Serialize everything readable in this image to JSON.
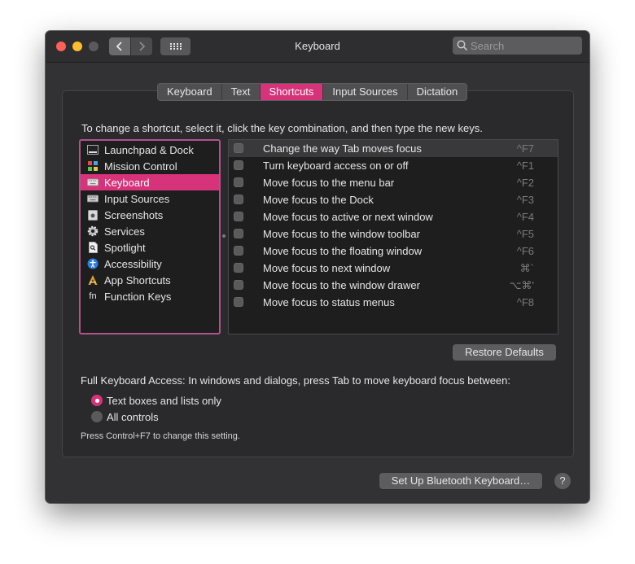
{
  "window": {
    "title": "Keyboard",
    "search_placeholder": "Search"
  },
  "tabs": [
    {
      "label": "Keyboard",
      "active": false
    },
    {
      "label": "Text",
      "active": false
    },
    {
      "label": "Shortcuts",
      "active": true
    },
    {
      "label": "Input Sources",
      "active": false
    },
    {
      "label": "Dictation",
      "active": false
    }
  ],
  "instructions": "To change a shortcut, select it, click the key combination, and then type the new keys.",
  "categories": [
    {
      "label": "Launchpad & Dock",
      "icon": "launchpad-dock-icon",
      "selected": false
    },
    {
      "label": "Mission Control",
      "icon": "mission-control-icon",
      "selected": false
    },
    {
      "label": "Keyboard",
      "icon": "keyboard-icon",
      "selected": true
    },
    {
      "label": "Input Sources",
      "icon": "input-sources-icon",
      "selected": false
    },
    {
      "label": "Screenshots",
      "icon": "screenshots-icon",
      "selected": false
    },
    {
      "label": "Services",
      "icon": "gear-icon",
      "selected": false
    },
    {
      "label": "Spotlight",
      "icon": "spotlight-icon",
      "selected": false
    },
    {
      "label": "Accessibility",
      "icon": "accessibility-icon",
      "selected": false
    },
    {
      "label": "App Shortcuts",
      "icon": "app-shortcuts-icon",
      "selected": false
    },
    {
      "label": "Function Keys",
      "icon": "fn-icon",
      "selected": false
    }
  ],
  "shortcuts": [
    {
      "label": "Change the way Tab moves focus",
      "key": "^F7",
      "checked": false
    },
    {
      "label": "Turn keyboard access on or off",
      "key": "^F1",
      "checked": false
    },
    {
      "label": "Move focus to the menu bar",
      "key": "^F2",
      "checked": false
    },
    {
      "label": "Move focus to the Dock",
      "key": "^F3",
      "checked": false
    },
    {
      "label": "Move focus to active or next window",
      "key": "^F4",
      "checked": false
    },
    {
      "label": "Move focus to the window toolbar",
      "key": "^F5",
      "checked": false
    },
    {
      "label": "Move focus to the floating window",
      "key": "^F6",
      "checked": false
    },
    {
      "label": "Move focus to next window",
      "key": "⌘`",
      "checked": false
    },
    {
      "label": "Move focus to the window drawer",
      "key": "⌥⌘'",
      "checked": false
    },
    {
      "label": "Move focus to status menus",
      "key": "^F8",
      "checked": false
    }
  ],
  "restore_defaults": "Restore Defaults",
  "full_keyboard_access": {
    "label": "Full Keyboard Access: In windows and dialogs, press Tab to move keyboard focus between:",
    "options": [
      {
        "label": "Text boxes and lists only",
        "selected": true
      },
      {
        "label": "All controls",
        "selected": false
      }
    ],
    "hint": "Press Control+F7 to change this setting."
  },
  "bluetooth_button": "Set Up Bluetooth Keyboard…",
  "help_button": "?",
  "colors": {
    "accent": "#d6337a",
    "window_bg": "#323234",
    "list_bg": "#1e1e1f"
  }
}
